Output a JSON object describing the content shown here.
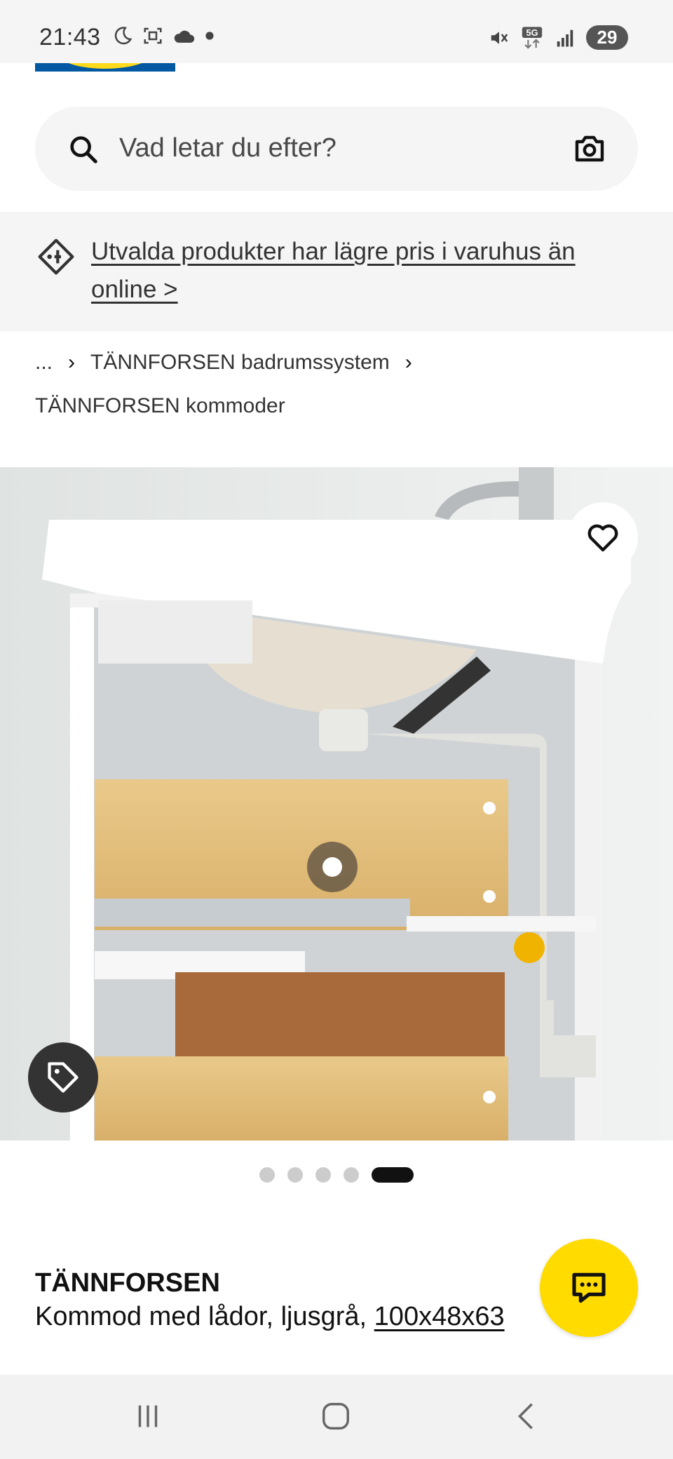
{
  "status_bar": {
    "time": "21:43",
    "battery": "29",
    "icons": [
      "moon-icon",
      "screenshot-icon",
      "cloud-icon",
      "dot-icon",
      "mute-icon",
      "5g-icon",
      "signal-icon"
    ]
  },
  "search": {
    "placeholder": "Vad letar du efter?"
  },
  "promo": {
    "text": "Utvalda produkter har lägre pris i varuhus än online >"
  },
  "breadcrumb": {
    "ellipsis": "...",
    "level1": "TÄNNFORSEN badrumssystem",
    "level2": "TÄNNFORSEN kommoder"
  },
  "carousel": {
    "count": 5,
    "active_index": 4
  },
  "product": {
    "name": "TÄNNFORSEN",
    "description_prefix": "Kommod med lådor, ljusgrå, ",
    "size": "100x48x63"
  },
  "colors": {
    "brand_blue": "#0058a3",
    "brand_yellow": "#ffdb00",
    "text_dark": "#111111",
    "surface_grey": "#f5f5f5"
  }
}
